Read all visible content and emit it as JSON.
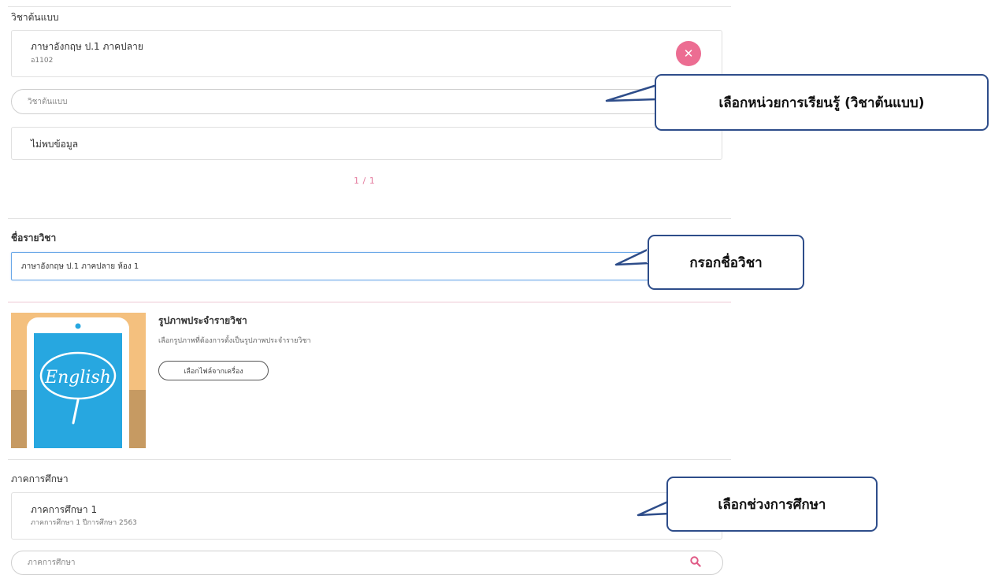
{
  "template_subject": {
    "label": "วิชาต้นแบบ",
    "selected": {
      "title": "ภาษาอังกฤษ ป.1 ภาคปลาย",
      "code": "อ1102"
    },
    "remove_icon": "close-icon",
    "search_placeholder": "วิชาต้นแบบ",
    "empty_result": "ไม่พบข้อมูล",
    "pagination": "1 / 1"
  },
  "subject_name": {
    "label": "ชื่อรายวิชา",
    "value": "ภาษาอังกฤษ ป.1 ภาคปลาย ห้อง 1"
  },
  "subject_image": {
    "title": "รูปภาพประจำรายวิชา",
    "description": "เลือกรูปภาพที่ต้องการตั้งเป็นรูปภาพประจำรายวิชา",
    "choose_button": "เลือกไฟล์จากเครื่อง",
    "thumbnail_text": "English"
  },
  "semester": {
    "label": "ภาคการศึกษา",
    "selected": {
      "title": "ภาคการศึกษา 1",
      "detail": "ภาคการศึกษา 1 ปีการศึกษา 2563"
    },
    "search_placeholder": "ภาคการศึกษา",
    "search_icon": "search-icon"
  },
  "callouts": {
    "select_template": "เลือกหน่วยการเรียนรู้ (วิชาต้นแบบ)",
    "enter_name": "กรอกชื่อวิชา",
    "select_semester": "เลือกช่วงการศึกษา"
  },
  "colors": {
    "accent_pink": "#ec6d92",
    "pagination_pink": "#e47a9d",
    "callout_border": "#2e4d8a",
    "input_focus": "#6aa8e8",
    "thumbnail_screen": "#27a7e0"
  }
}
